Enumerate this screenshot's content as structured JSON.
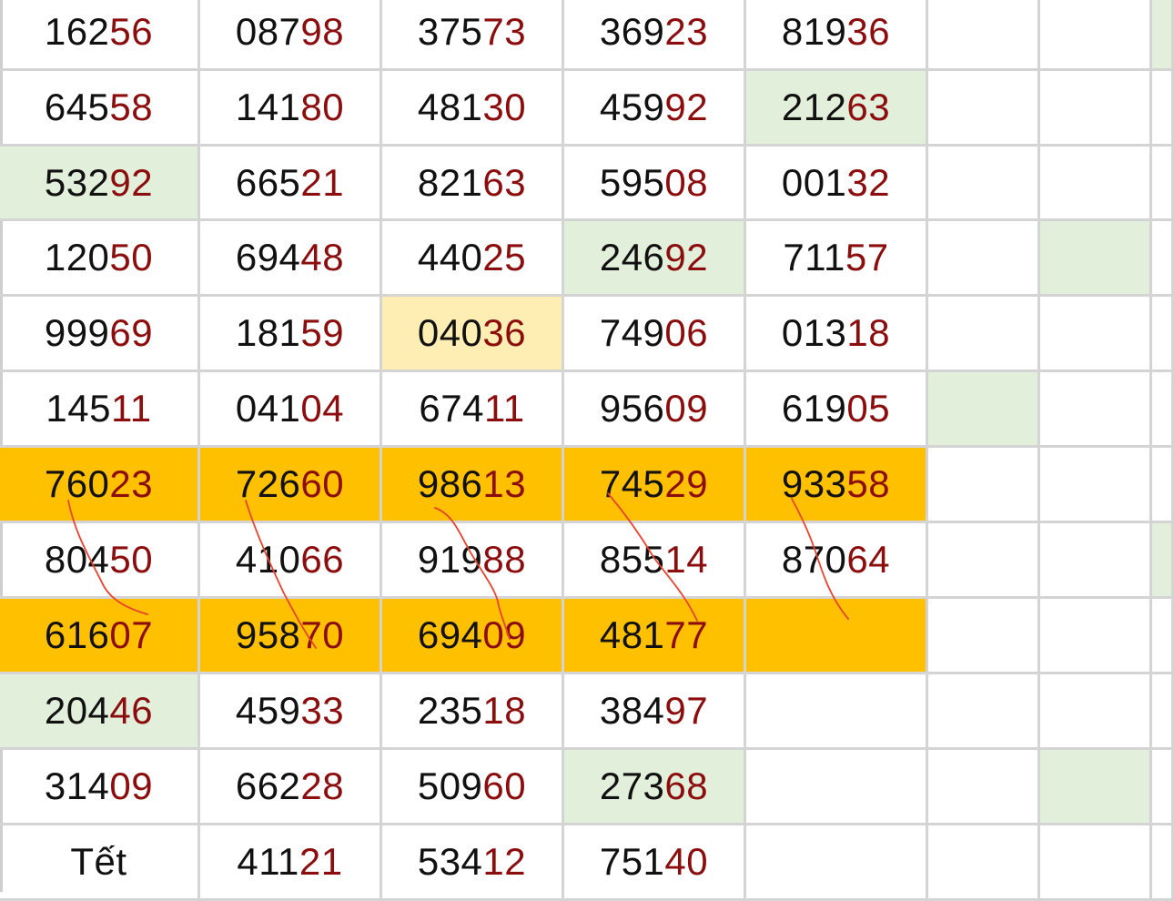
{
  "colors": {
    "grid_line": "#d4d4d4",
    "digit_text": "#111111",
    "tail_digits": "#8b0d0d",
    "green_fill": "#e2efda",
    "amber_fill": "#ffc000",
    "light_amber_fill": "#ffeeb3",
    "annotation_stroke": "#e8432e"
  },
  "rows": [
    {
      "cells": [
        {
          "v": "16256"
        },
        {
          "v": "08798"
        },
        {
          "v": "37573"
        },
        {
          "v": "36923"
        },
        {
          "v": "81936"
        },
        {
          "v": ""
        },
        {
          "v": ""
        },
        {
          "v": "",
          "fill": "green"
        }
      ]
    },
    {
      "cells": [
        {
          "v": "64558"
        },
        {
          "v": "14180"
        },
        {
          "v": "48130"
        },
        {
          "v": "45992"
        },
        {
          "v": "21263",
          "fill": "green"
        },
        {
          "v": ""
        },
        {
          "v": ""
        },
        {
          "v": ""
        }
      ]
    },
    {
      "cells": [
        {
          "v": "53292",
          "fill": "green"
        },
        {
          "v": "66521"
        },
        {
          "v": "82163"
        },
        {
          "v": "59508"
        },
        {
          "v": "00132"
        },
        {
          "v": ""
        },
        {
          "v": ""
        },
        {
          "v": ""
        }
      ]
    },
    {
      "cells": [
        {
          "v": "12050"
        },
        {
          "v": "69448"
        },
        {
          "v": "44025"
        },
        {
          "v": "24692",
          "fill": "green"
        },
        {
          "v": "71157"
        },
        {
          "v": ""
        },
        {
          "v": "",
          "fill": "green"
        },
        {
          "v": ""
        }
      ]
    },
    {
      "cells": [
        {
          "v": "99969"
        },
        {
          "v": "18159"
        },
        {
          "v": "04036",
          "fill": "light_amber"
        },
        {
          "v": "74906"
        },
        {
          "v": "01318"
        },
        {
          "v": ""
        },
        {
          "v": ""
        },
        {
          "v": ""
        }
      ]
    },
    {
      "cells": [
        {
          "v": "14511"
        },
        {
          "v": "04104"
        },
        {
          "v": "67411"
        },
        {
          "v": "95609"
        },
        {
          "v": "61905"
        },
        {
          "v": "",
          "fill": "green"
        },
        {
          "v": ""
        },
        {
          "v": ""
        }
      ]
    },
    {
      "cells": [
        {
          "v": "76023",
          "fill": "amber"
        },
        {
          "v": "72660",
          "fill": "amber"
        },
        {
          "v": "98613",
          "fill": "amber"
        },
        {
          "v": "74529",
          "fill": "amber"
        },
        {
          "v": "93358",
          "fill": "amber"
        },
        {
          "v": ""
        },
        {
          "v": ""
        },
        {
          "v": ""
        }
      ]
    },
    {
      "cells": [
        {
          "v": "80450"
        },
        {
          "v": "41066"
        },
        {
          "v": "91988"
        },
        {
          "v": "85514"
        },
        {
          "v": "87064"
        },
        {
          "v": ""
        },
        {
          "v": ""
        },
        {
          "v": "",
          "fill": "green"
        }
      ]
    },
    {
      "cells": [
        {
          "v": "61607",
          "fill": "amber"
        },
        {
          "v": "95870",
          "fill": "amber"
        },
        {
          "v": "69409",
          "fill": "amber"
        },
        {
          "v": "48177",
          "fill": "amber"
        },
        {
          "v": "",
          "fill": "amber"
        },
        {
          "v": ""
        },
        {
          "v": ""
        },
        {
          "v": ""
        }
      ]
    },
    {
      "cells": [
        {
          "v": "20446",
          "fill": "green"
        },
        {
          "v": "45933"
        },
        {
          "v": "23518"
        },
        {
          "v": "38497"
        },
        {
          "v": ""
        },
        {
          "v": ""
        },
        {
          "v": ""
        },
        {
          "v": ""
        }
      ]
    },
    {
      "cells": [
        {
          "v": "31409"
        },
        {
          "v": "66228"
        },
        {
          "v": "50960"
        },
        {
          "v": "27368",
          "fill": "green"
        },
        {
          "v": ""
        },
        {
          "v": ""
        },
        {
          "v": "",
          "fill": "green"
        },
        {
          "v": ""
        }
      ]
    },
    {
      "cells": [
        {
          "v": "Tết",
          "plain": true
        },
        {
          "v": "41121"
        },
        {
          "v": "53412"
        },
        {
          "v": "75140"
        },
        {
          "v": ""
        },
        {
          "v": ""
        },
        {
          "v": ""
        },
        {
          "v": ""
        }
      ]
    }
  ]
}
